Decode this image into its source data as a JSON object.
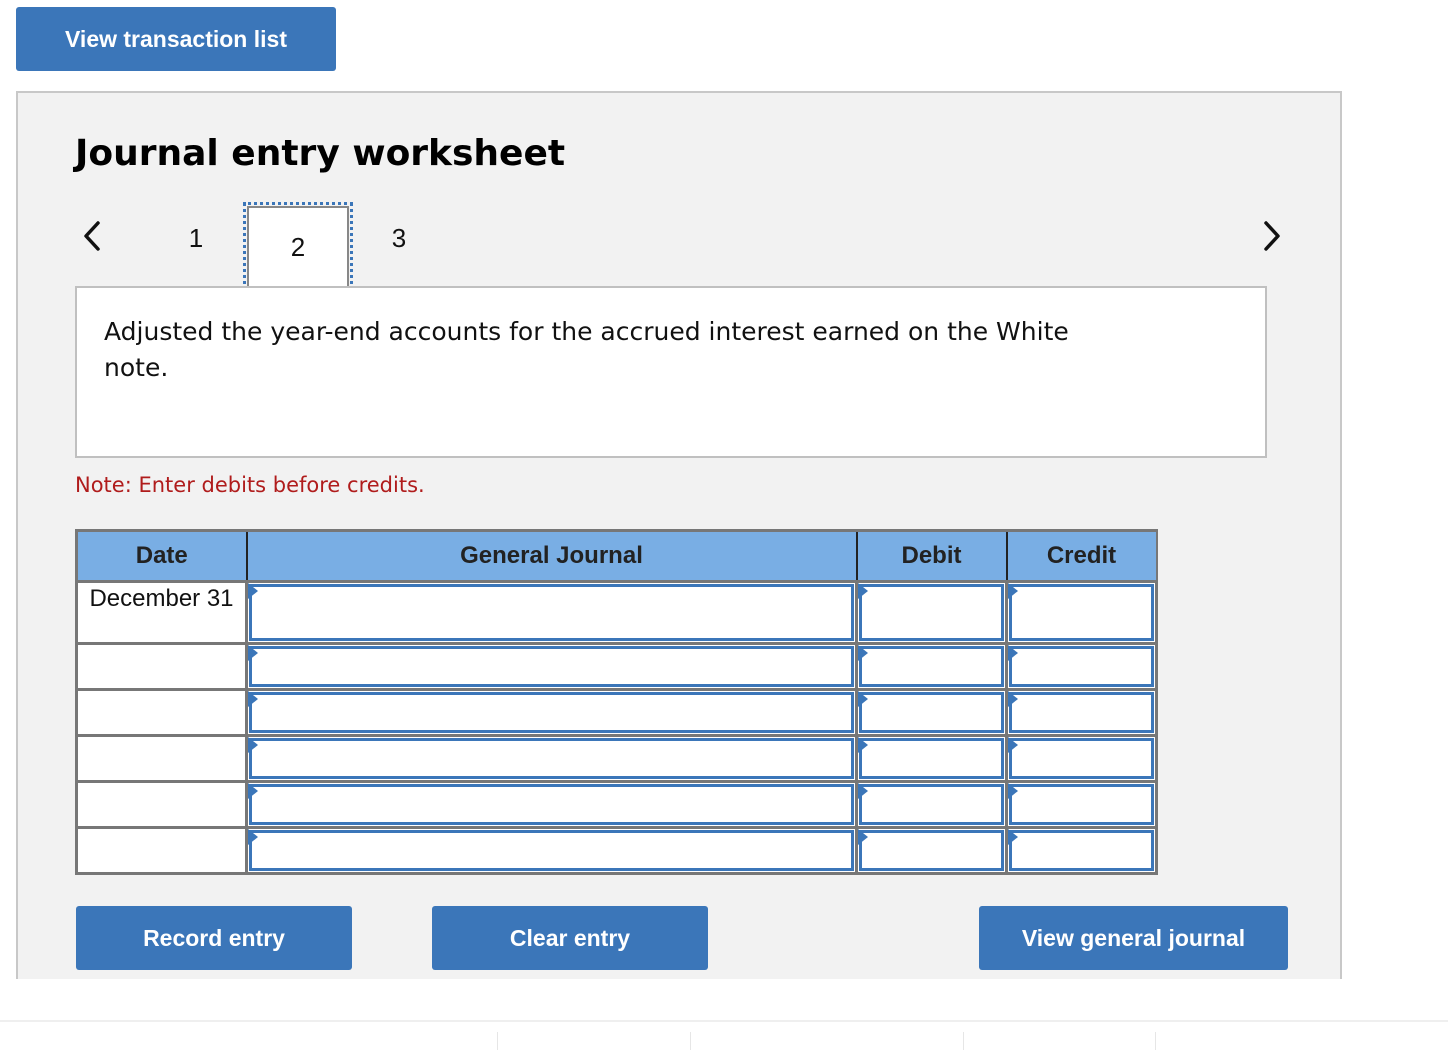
{
  "header": {
    "view_transaction_label": "View transaction list"
  },
  "worksheet": {
    "title": "Journal entry worksheet",
    "nav": {
      "prev_icon": "chevron-left-icon",
      "next_icon": "chevron-right-icon",
      "pages": [
        "1",
        "2",
        "3"
      ],
      "active_page": "2"
    },
    "description": "Adjusted the year-end accounts for the accrued interest earned on the White note.",
    "note": "Note: Enter debits before credits."
  },
  "journal": {
    "columns": [
      "Date",
      "General Journal",
      "Debit",
      "Credit"
    ],
    "rows": [
      {
        "date": "December 31",
        "account": "",
        "debit": "",
        "credit": ""
      },
      {
        "date": "",
        "account": "",
        "debit": "",
        "credit": ""
      },
      {
        "date": "",
        "account": "",
        "debit": "",
        "credit": ""
      },
      {
        "date": "",
        "account": "",
        "debit": "",
        "credit": ""
      },
      {
        "date": "",
        "account": "",
        "debit": "",
        "credit": ""
      },
      {
        "date": "",
        "account": "",
        "debit": "",
        "credit": ""
      }
    ]
  },
  "buttons": {
    "record_entry": "Record entry",
    "clear_entry": "Clear entry",
    "view_general_journal": "View general journal"
  },
  "colors": {
    "accent": "#3b76b9",
    "header_bg": "#79aee4",
    "note": "#b01c1c",
    "panel_bg": "#f2f2f2"
  }
}
